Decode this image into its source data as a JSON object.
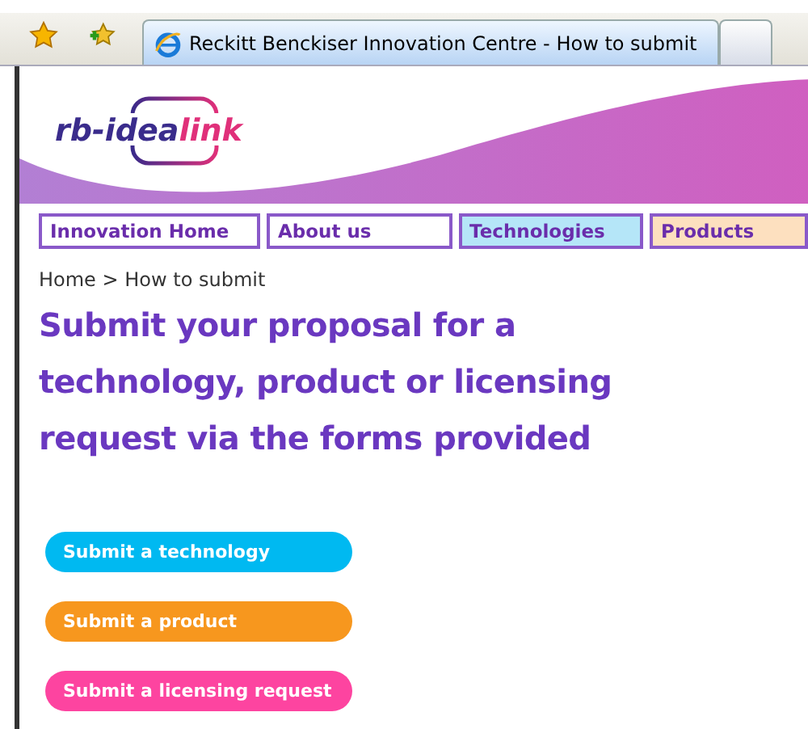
{
  "browser_tabs": [
    {
      "title": "Reckitt Benckiser Innovation Centre - How to submit",
      "selected": true
    },
    {
      "selected": false
    }
  ],
  "logo": {
    "text_dark": "rb-idea",
    "text_accent": "link"
  },
  "nav": [
    {
      "label": "Innovation Home",
      "color": "#ffffff"
    },
    {
      "label": "About us",
      "color": "#ffffff"
    },
    {
      "label": "Technologies",
      "color": "#b5e6f8"
    },
    {
      "label": "Products",
      "color": "#fde0bf"
    }
  ],
  "breadcrumb": "Home > How to submit",
  "heading": "Submit your proposal for a technology, product or licensing request via the forms provided",
  "buttons": [
    {
      "label": "Submit a technology",
      "color": "#00b9f1"
    },
    {
      "label": "Submit a product",
      "color": "#f7971e"
    },
    {
      "label": "Submit a licensing request",
      "color": "#fd44a0"
    }
  ]
}
